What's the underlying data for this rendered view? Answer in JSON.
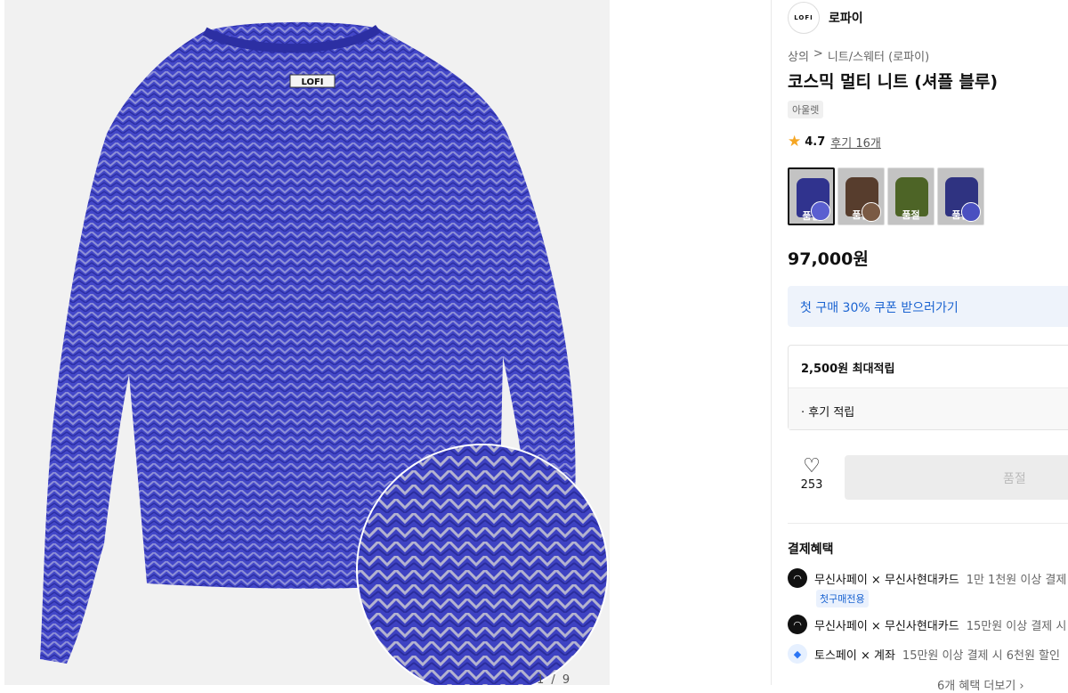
{
  "gallery": {
    "logo_label": "LOFI",
    "page_indicator": "1 / 9"
  },
  "brand": {
    "logo_text": "LOFI",
    "name": "로파이"
  },
  "breadcrumb": {
    "category": "상의",
    "separator": ">",
    "subcategory": "니트/스웨터 (로파이)"
  },
  "product": {
    "title": "코스믹 멀티 니트 (셔플 블루)",
    "tag": "아울렛",
    "rating": "4.7",
    "reviews_link": "후기 16개",
    "price": "97,000원"
  },
  "swatches": [
    {
      "label": "품절",
      "color": "#3b3fae",
      "active": true
    },
    {
      "label": "품절",
      "color": "#6b4b37",
      "active": false
    },
    {
      "label": "품절",
      "color": "#5f7b2f",
      "active": false
    },
    {
      "label": "품절",
      "color": "#3a3f9e",
      "active": false
    }
  ],
  "coupon": {
    "text": "첫 구매 30% 쿠폰 받으러가기"
  },
  "points": {
    "max": "2,500원 최대적립",
    "review": "· 후기 적립"
  },
  "actions": {
    "like_count": "253",
    "buy_label": "품절"
  },
  "benefits": {
    "title": "결제혜택",
    "items": [
      {
        "icon": "musinsa-pay-icon",
        "strong": "무신사페이 × 무신사현대카드",
        "detail": "1만 1천원 이상 결제"
      },
      {
        "icon": "musinsa-pay-icon",
        "strong": "무신사페이 × 무신사현대카드",
        "detail": "15만원 이상 결제 시"
      },
      {
        "icon": "toss-pay-icon",
        "strong": "토스페이 × 계좌",
        "detail": "15만원 이상 결제 시 6천원 할인"
      }
    ],
    "first_badge": "첫구매전용",
    "more": "6개 혜택 더보기 ›"
  },
  "colors": {
    "accent_blue": "#1a63d1",
    "sweater_blue": "#3d41c8",
    "coupon_bg": "#eef3fb"
  }
}
